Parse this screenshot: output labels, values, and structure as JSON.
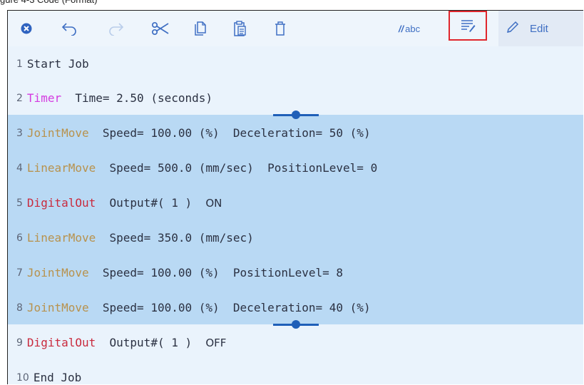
{
  "caption": "gure 4-3 Code (Format)",
  "toolbar": {
    "comment_label": "abc",
    "comment_prefix": "//",
    "edit_label": "Edit"
  },
  "lines": [
    {
      "num": "1",
      "kw": "Start Job",
      "kw_type": "plain",
      "params": ""
    },
    {
      "num": "2",
      "kw": "Timer",
      "kw_type": "timer",
      "params": "  Time= 2.50 (seconds)"
    },
    {
      "num": "3",
      "kw": "JointMove",
      "kw_type": "move",
      "params": "  Speed= 100.00 (%)  Deceleration= 50 (%)"
    },
    {
      "num": "4",
      "kw": "LinearMove",
      "kw_type": "move",
      "params": "  Speed= 500.0 (mm/sec)  PositionLevel= 0"
    },
    {
      "num": "5",
      "kw": "DigitalOut",
      "kw_type": "out",
      "params": "  Output#( 1 )  ",
      "state": "ON"
    },
    {
      "num": "6",
      "kw": "LinearMove",
      "kw_type": "move",
      "params": "  Speed= 350.0 (mm/sec)"
    },
    {
      "num": "7",
      "kw": "JointMove",
      "kw_type": "move",
      "params": "  Speed= 100.00 (%)  PositionLevel= 8"
    },
    {
      "num": "8",
      "kw": "JointMove",
      "kw_type": "move",
      "params": "  Speed= 100.00 (%)  Deceleration= 40 (%)"
    },
    {
      "num": "9",
      "kw": "DigitalOut",
      "kw_type": "out",
      "params": "  Output#( 1 )  ",
      "state": "OFF"
    },
    {
      "num": "10",
      "kw": "End Job",
      "kw_type": "plain",
      "params": ""
    }
  ],
  "selection": {
    "first_line": 3,
    "last_line": 8
  },
  "colors": {
    "accent": "#3f6fc3",
    "selection": "#b9d9f4",
    "highlight_box": "#e0262d",
    "timer_keyword": "#d43be0",
    "move_keyword": "#b8924d",
    "output_keyword": "#c92a3d"
  },
  "icons": [
    "close-circle-icon",
    "undo-icon",
    "redo-icon",
    "cut-icon",
    "copy-icon",
    "paste-icon",
    "delete-icon",
    "comment-icon",
    "format-icon",
    "pencil-icon"
  ]
}
